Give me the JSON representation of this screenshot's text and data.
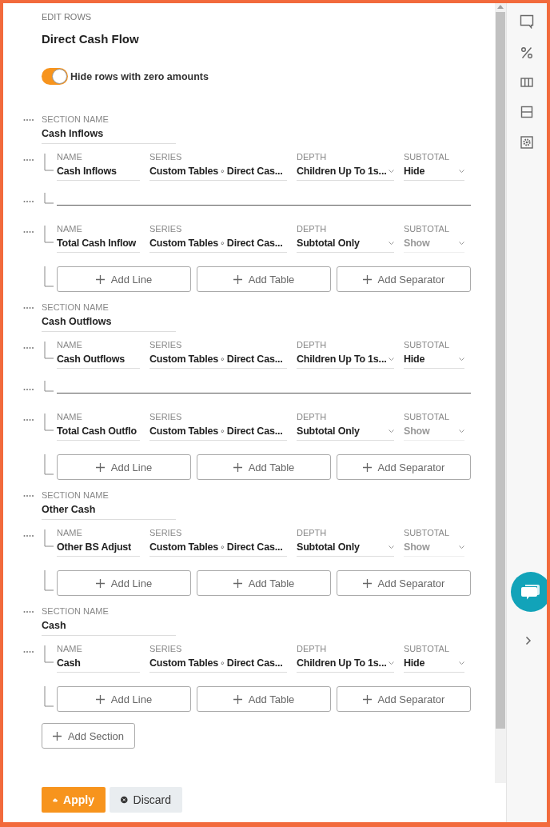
{
  "header": {
    "kicker": "EDIT ROWS",
    "title": "Direct Cash Flow"
  },
  "toggle": {
    "label": "Hide rows with zero amounts",
    "on": true
  },
  "sections": [
    {
      "label": "SECTION NAME",
      "name": "Cash Inflows",
      "rows": [
        {
          "kind": "line",
          "fields": [
            {
              "kind": "text",
              "label": "NAME",
              "value": "Cash Inflows",
              "disabled": false
            },
            {
              "kind": "text",
              "label": "SERIES",
              "value": "Custom Tables ◦ Direct Cas...",
              "disabled": false
            },
            {
              "kind": "select",
              "label": "DEPTH",
              "value": "Children Up To 1s...",
              "disabled": false
            },
            {
              "kind": "select",
              "label": "SUBTOTAL",
              "value": "Hide",
              "disabled": false
            }
          ]
        },
        {
          "kind": "separator"
        },
        {
          "kind": "line",
          "fields": [
            {
              "kind": "text",
              "label": "NAME",
              "value": "Total Cash Inflow",
              "disabled": false
            },
            {
              "kind": "text",
              "label": "SERIES",
              "value": "Custom Tables ◦ Direct Cas...",
              "disabled": false
            },
            {
              "kind": "select",
              "label": "DEPTH",
              "value": "Subtotal Only",
              "disabled": false
            },
            {
              "kind": "select",
              "label": "SUBTOTAL",
              "value": "Show",
              "disabled": true
            }
          ]
        }
      ],
      "add_buttons": [
        "Add Line",
        "Add Table",
        "Add Separator"
      ]
    },
    {
      "label": "SECTION NAME",
      "name": "Cash Outflows",
      "rows": [
        {
          "kind": "line",
          "fields": [
            {
              "kind": "text",
              "label": "NAME",
              "value": "Cash Outflows",
              "disabled": false
            },
            {
              "kind": "text",
              "label": "SERIES",
              "value": "Custom Tables ◦ Direct Cas...",
              "disabled": false
            },
            {
              "kind": "select",
              "label": "DEPTH",
              "value": "Children Up To 1s...",
              "disabled": false
            },
            {
              "kind": "select",
              "label": "SUBTOTAL",
              "value": "Hide",
              "disabled": false
            }
          ]
        },
        {
          "kind": "separator"
        },
        {
          "kind": "line",
          "fields": [
            {
              "kind": "text",
              "label": "NAME",
              "value": "Total Cash Outflo",
              "disabled": false
            },
            {
              "kind": "text",
              "label": "SERIES",
              "value": "Custom Tables ◦ Direct Cas...",
              "disabled": false
            },
            {
              "kind": "select",
              "label": "DEPTH",
              "value": "Subtotal Only",
              "disabled": false
            },
            {
              "kind": "select",
              "label": "SUBTOTAL",
              "value": "Show",
              "disabled": true
            }
          ]
        }
      ],
      "add_buttons": [
        "Add Line",
        "Add Table",
        "Add Separator"
      ]
    },
    {
      "label": "SECTION NAME",
      "name": "Other Cash",
      "rows": [
        {
          "kind": "line",
          "fields": [
            {
              "kind": "text",
              "label": "NAME",
              "value": "Other BS Adjust",
              "disabled": false
            },
            {
              "kind": "text",
              "label": "SERIES",
              "value": "Custom Tables ◦ Direct Cas...",
              "disabled": false
            },
            {
              "kind": "select",
              "label": "DEPTH",
              "value": "Subtotal Only",
              "disabled": false
            },
            {
              "kind": "select",
              "label": "SUBTOTAL",
              "value": "Show",
              "disabled": true
            }
          ]
        }
      ],
      "add_buttons": [
        "Add Line",
        "Add Table",
        "Add Separator"
      ]
    },
    {
      "label": "SECTION NAME",
      "name": "Cash",
      "rows": [
        {
          "kind": "line",
          "fields": [
            {
              "kind": "text",
              "label": "NAME",
              "value": "Cash",
              "disabled": false
            },
            {
              "kind": "text",
              "label": "SERIES",
              "value": "Custom Tables ◦ Direct Cas...",
              "disabled": false
            },
            {
              "kind": "select",
              "label": "DEPTH",
              "value": "Children Up To 1s...",
              "disabled": false
            },
            {
              "kind": "select",
              "label": "SUBTOTAL",
              "value": "Hide",
              "disabled": false
            }
          ]
        }
      ],
      "add_buttons": [
        "Add Line",
        "Add Table",
        "Add Separator"
      ]
    }
  ],
  "add_section": "Add Section",
  "actions": [
    {
      "kind": "apply",
      "label": "Apply"
    },
    {
      "kind": "discard",
      "label": "Discard"
    }
  ]
}
